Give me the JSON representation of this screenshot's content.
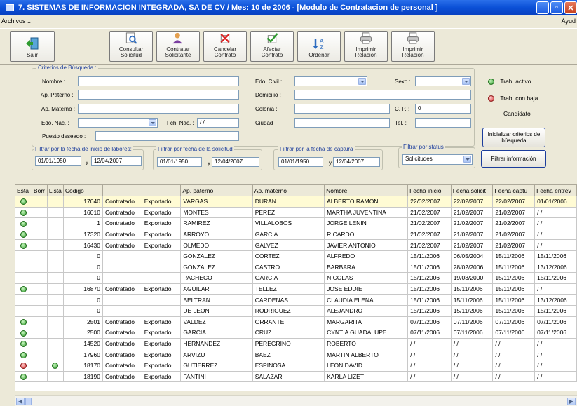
{
  "window": {
    "title": "7. SISTEMAS DE INFORMACION INTEGRADA, SA DE CV / Mes: 10 de 2006 - [Modulo de Contratacion de personal ]"
  },
  "menu": {
    "left": "Archivos ..",
    "right": "Ayud"
  },
  "toolbar": {
    "salir": "Salir",
    "consultar_solicitud": "Consultar Solicitud",
    "contratar_solicitante": "Contratar Solicitante",
    "cancelar_contrato": "Cancelar Contrato",
    "afectar_contrato": "Afectar Contrato",
    "ordenar": "Ordenar",
    "imprimir_relacion_1": "Imprimir Relación",
    "imprimir_relacion_2": "Imprimir Relación"
  },
  "criteria": {
    "legend": "Criterios de Búsqueda :",
    "nombre_label": "Nombre :",
    "nombre": "",
    "ap_paterno_label": "Ap. Paterno :",
    "ap_paterno": "",
    "ap_materno_label": "Ap. Materno :",
    "ap_materno": "",
    "edo_nac_label": "Edo. Nac. :",
    "edo_nac": "",
    "fch_nac_label": "Fch. Nac. :",
    "fch_nac": " / /",
    "puesto_label": "Puesto deseado :",
    "puesto": "",
    "edo_civil_label": "Edo. Civil :",
    "edo_civil": "",
    "sexo_label": "Sexo :",
    "sexo": "",
    "domicilio_label": "Domicilio :",
    "domicilio": "",
    "colonia_label": "Colonia :",
    "colonia": "",
    "cp_label": "C. P. :",
    "cp": "0",
    "ciudad_label": "Ciudad",
    "ciudad": "",
    "tel_label": "Tel. :",
    "tel": ""
  },
  "status_legend": {
    "activo": "Trab. activo",
    "baja": "Trab. con baja",
    "candidato": "Candidato"
  },
  "buttons": {
    "inicializar": "Inicializar criterios de búsqueda",
    "filtrar": "Filtrar información"
  },
  "filters": {
    "inicio": {
      "legend": "Filtrar por la fecha de inicio de labores:",
      "from": "01/01/1950",
      "y": "y",
      "to": "12/04/2007"
    },
    "solicitud": {
      "legend": "Filtrar por fecha de la solicitud",
      "from": "01/01/1950",
      "y": "y",
      "to": "12/04/2007"
    },
    "captura": {
      "legend": "Filtrar por la fecha de captura",
      "from": "01/01/1950",
      "y": "y",
      "to": "12/04/2007"
    },
    "status": {
      "legend": "Filtrar por status",
      "value": "Solicitudes"
    }
  },
  "table": {
    "headers": [
      "Esta",
      "Borr",
      "Lista",
      "Código",
      "",
      "",
      "Ap. paterno",
      "Ap. materno",
      "Nombre",
      "Fecha inicio",
      "Fecha solicit",
      "Fecha captu",
      "Fecha entrev"
    ],
    "rows": [
      {
        "s": "g",
        "b": "",
        "l": "",
        "cod": "17040",
        "c1": "Contratado",
        "c2": "Exportado",
        "ap": "VARGAS",
        "am": "DURAN",
        "nom": "ALBERTO RAMON",
        "fi": "22/02/2007",
        "fs": "22/02/2007",
        "fc": "22/02/2007",
        "fe": "01/01/2006"
      },
      {
        "s": "g",
        "b": "",
        "l": "",
        "cod": "16010",
        "c1": "Contratado",
        "c2": "Exportado",
        "ap": "MONTES",
        "am": "PEREZ",
        "nom": "MARTHA JUVENTINA",
        "fi": "21/02/2007",
        "fs": "21/02/2007",
        "fc": "21/02/2007",
        "fe": " / /"
      },
      {
        "s": "g",
        "b": "",
        "l": "",
        "cod": "1",
        "c1": "Contratado",
        "c2": "Exportado",
        "ap": "RAMIREZ",
        "am": "VILLALOBOS",
        "nom": "JORGE LENIN",
        "fi": "21/02/2007",
        "fs": "21/02/2007",
        "fc": "21/02/2007",
        "fe": " / /"
      },
      {
        "s": "g",
        "b": "",
        "l": "",
        "cod": "17320",
        "c1": "Contratado",
        "c2": "Exportado",
        "ap": "ARROYO",
        "am": "GARCIA",
        "nom": "RICARDO",
        "fi": "21/02/2007",
        "fs": "21/02/2007",
        "fc": "21/02/2007",
        "fe": " / /"
      },
      {
        "s": "g",
        "b": "",
        "l": "",
        "cod": "16430",
        "c1": "Contratado",
        "c2": "Exportado",
        "ap": "OLMEDO",
        "am": "GALVEZ",
        "nom": "JAVIER ANTONIO",
        "fi": "21/02/2007",
        "fs": "21/02/2007",
        "fc": "21/02/2007",
        "fe": " / /"
      },
      {
        "s": "",
        "b": "",
        "l": "",
        "cod": "0",
        "c1": "",
        "c2": "",
        "ap": "GONZALEZ",
        "am": "CORTEZ",
        "nom": "ALFREDO",
        "fi": "15/11/2006",
        "fs": "06/05/2004",
        "fc": "15/11/2006",
        "fe": "15/11/2006"
      },
      {
        "s": "",
        "b": "",
        "l": "",
        "cod": "0",
        "c1": "",
        "c2": "",
        "ap": "GONZALEZ",
        "am": "CASTRO",
        "nom": "BARBARA",
        "fi": "15/11/2006",
        "fs": "28/02/2006",
        "fc": "15/11/2006",
        "fe": "13/12/2006"
      },
      {
        "s": "",
        "b": "",
        "l": "",
        "cod": "0",
        "c1": "",
        "c2": "",
        "ap": "PACHECO",
        "am": "GARCIA",
        "nom": "NICOLAS",
        "fi": "15/11/2006",
        "fs": "19/03/2000",
        "fc": "15/11/2006",
        "fe": "15/11/2006"
      },
      {
        "s": "g",
        "b": "",
        "l": "",
        "cod": "16870",
        "c1": "Contratado",
        "c2": "Exportado",
        "ap": "AGUILAR",
        "am": "TELLEZ",
        "nom": "JOSE EDDIE",
        "fi": "15/11/2006",
        "fs": "15/11/2006",
        "fc": "15/11/2006",
        "fe": " / /"
      },
      {
        "s": "",
        "b": "",
        "l": "",
        "cod": "0",
        "c1": "",
        "c2": "",
        "ap": "BELTRAN",
        "am": "CARDENAS",
        "nom": "CLAUDIA ELENA",
        "fi": "15/11/2006",
        "fs": "15/11/2006",
        "fc": "15/11/2006",
        "fe": "13/12/2006"
      },
      {
        "s": "",
        "b": "",
        "l": "",
        "cod": "0",
        "c1": "",
        "c2": "",
        "ap": "DE LEON",
        "am": "RODRIGUEZ",
        "nom": "ALEJANDRO",
        "fi": "15/11/2006",
        "fs": "15/11/2006",
        "fc": "15/11/2006",
        "fe": "15/11/2006"
      },
      {
        "s": "g",
        "b": "",
        "l": "",
        "cod": "2501",
        "c1": "Contratado",
        "c2": "Exportado",
        "ap": "VALDEZ",
        "am": "ORRANTE",
        "nom": "MARGARITA",
        "fi": "07/11/2006",
        "fs": "07/11/2006",
        "fc": "07/11/2006",
        "fe": "07/11/2006"
      },
      {
        "s": "g",
        "b": "",
        "l": "",
        "cod": "2500",
        "c1": "Contratado",
        "c2": "Exportado",
        "ap": "GARCIA",
        "am": "CRUZ",
        "nom": "CYNTIA GUADALUPE",
        "fi": "07/11/2006",
        "fs": "07/11/2006",
        "fc": "07/11/2006",
        "fe": "07/11/2006"
      },
      {
        "s": "g",
        "b": "",
        "l": "",
        "cod": "14520",
        "c1": "Contratado",
        "c2": "Exportado",
        "ap": "HERNANDEZ",
        "am": "PEREGRINO",
        "nom": "ROBERTO",
        "fi": " / /",
        "fs": " / /",
        "fc": " / /",
        "fe": " / /"
      },
      {
        "s": "g",
        "b": "",
        "l": "",
        "cod": "17960",
        "c1": "Contratado",
        "c2": "Exportado",
        "ap": "ARVIZU",
        "am": "BAEZ",
        "nom": "MARTIN ALBERTO",
        "fi": " / /",
        "fs": " / /",
        "fc": " / /",
        "fe": " / /"
      },
      {
        "s": "r",
        "b": "",
        "l": "g",
        "cod": "18170",
        "c1": "Contratado",
        "c2": "Exportado",
        "ap": "GUTIERREZ",
        "am": "ESPINOSA",
        "nom": "LEON DAVID",
        "fi": " / /",
        "fs": " / /",
        "fc": " / /",
        "fe": " / /"
      },
      {
        "s": "g",
        "b": "",
        "l": "",
        "cod": "18190",
        "c1": "Contratado",
        "c2": "Exportado",
        "ap": "FANTINI",
        "am": "SALAZAR",
        "nom": "KARLA LIZET",
        "fi": " / /",
        "fs": " / /",
        "fc": " / /",
        "fe": " / /"
      }
    ]
  }
}
